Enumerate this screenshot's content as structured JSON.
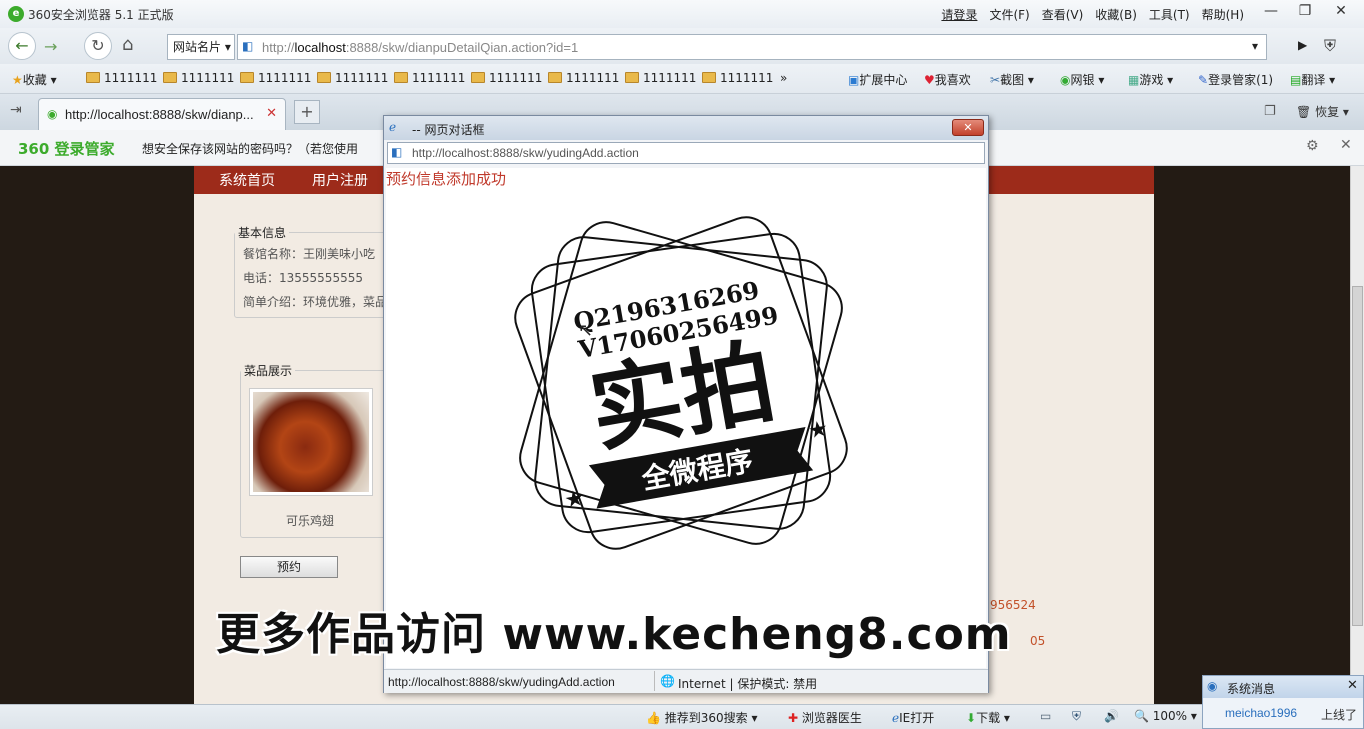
{
  "window": {
    "title": "360安全浏览器 5.1 正式版",
    "menus": [
      "请登录",
      "文件(F)",
      "查看(V)",
      "收藏(B)",
      "工具(T)",
      "帮助(H)"
    ]
  },
  "navbar": {
    "site_card": "网站名片",
    "url_prefix": "http://",
    "url_host": "localhost",
    "url_rest": ":8888/skw/dianpuDetailQian.action?id=1"
  },
  "bookmarks": {
    "fav_label": "收藏",
    "folders": [
      "1111111",
      "1111111",
      "1111111",
      "1111111",
      "1111111",
      "1111111",
      "1111111",
      "1111111",
      "1111111"
    ],
    "tools": [
      "扩展中心",
      "我喜欢",
      "截图",
      "网银",
      "游戏",
      "登录管家(1)",
      "翻译"
    ]
  },
  "tabs": {
    "active_tab": "http://localhost:8888/skw/dianp...",
    "restore_label": "恢复"
  },
  "password_bar": {
    "brand": "360 登录管家",
    "message": "想安全保存该网站的密码吗？（若您使用"
  },
  "site": {
    "nav_items": [
      "系统首页",
      "用户注册"
    ],
    "basic_info_legend": "基本信息",
    "name_line": "餐馆名称：王刚美味小吃",
    "phone_line": "电话：13555555555",
    "intro_line": "简单介绍：环境优雅，菜品",
    "dishes_legend": "菜品展示",
    "dish_name": "可乐鸡翅",
    "reserve_button": "预约",
    "side_text_1": "956524",
    "side_text_2": "05"
  },
  "dialog": {
    "title": "-- 网页对话框",
    "url": "http://localhost:8888/skw/yudingAdd.action",
    "message": "预约信息添加成功",
    "stamp_line1": "Q2196316269",
    "stamp_line2": "V17060256499",
    "stamp_main": "实拍",
    "stamp_ribbon": "全微程序",
    "status_url": "http://localhost:8888/skw/yudingAdd.action",
    "status_zone": "Internet | 保护模式: 禁用"
  },
  "watermark": "更多作品访问 www.kecheng8.com",
  "statusbar": {
    "items": [
      "推荐到360搜索",
      "浏览器医生",
      "IE打开",
      "下载"
    ],
    "zoom": "100%"
  },
  "system_message": {
    "title": "系统消息",
    "user": "meichao1996",
    "status": "上线了"
  }
}
